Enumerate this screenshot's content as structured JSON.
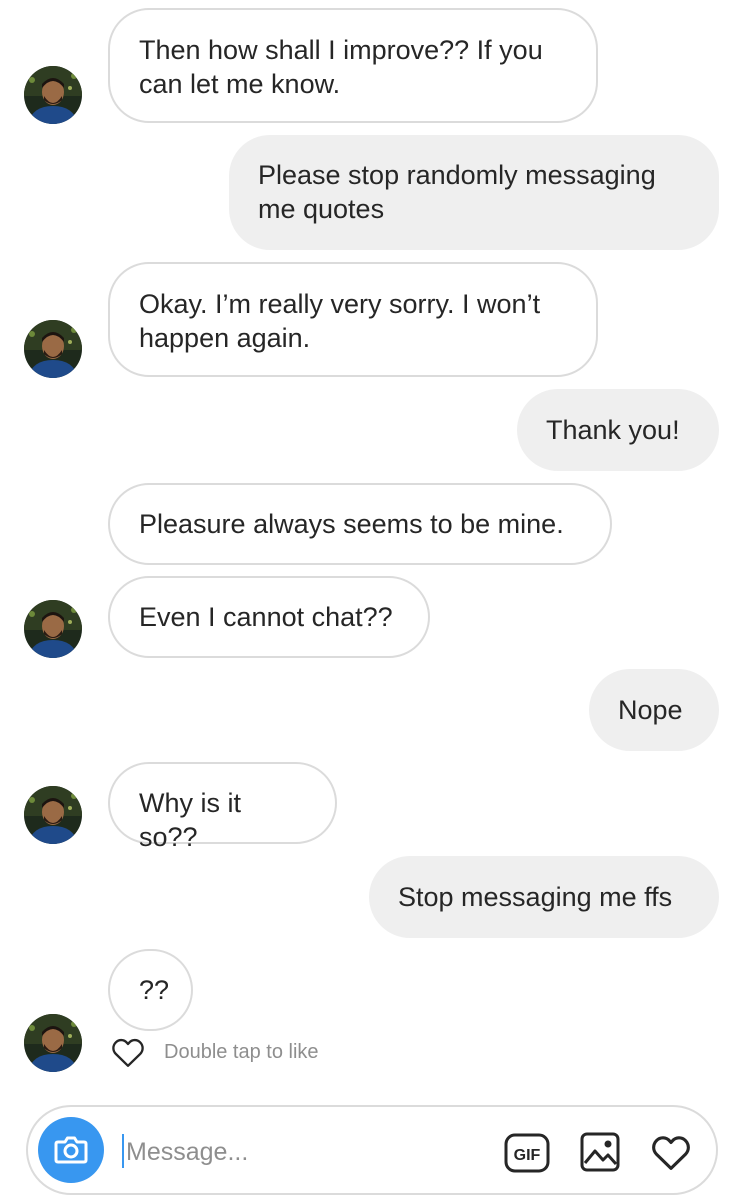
{
  "messages": [
    {
      "side": "in",
      "text": "Then how shall I improve?? If you\ncan let me know."
    },
    {
      "side": "out",
      "text": "Please stop randomly messaging\nme quotes"
    },
    {
      "side": "in",
      "text": "Okay. I’m really very sorry. I won’t\nhappen again."
    },
    {
      "side": "out",
      "text": "Thank you!"
    },
    {
      "side": "in",
      "text": "Pleasure always seems to be mine."
    },
    {
      "side": "in",
      "text": "Even I cannot chat??"
    },
    {
      "side": "out",
      "text": "Nope"
    },
    {
      "side": "in",
      "text": "Why is it so??"
    },
    {
      "side": "out",
      "text": "Stop messaging me ffs"
    },
    {
      "side": "in",
      "text": "??"
    }
  ],
  "like_hint": "Double tap to like",
  "composer": {
    "placeholder": "Message...",
    "gif_label": "GIF"
  },
  "colors": {
    "accent": "#3897f0",
    "outgoing_bubble": "#efefef",
    "incoming_border": "#dbdbdb"
  },
  "icons": [
    "camera-icon",
    "gif-icon",
    "image-icon",
    "heart-icon",
    "avatar"
  ]
}
